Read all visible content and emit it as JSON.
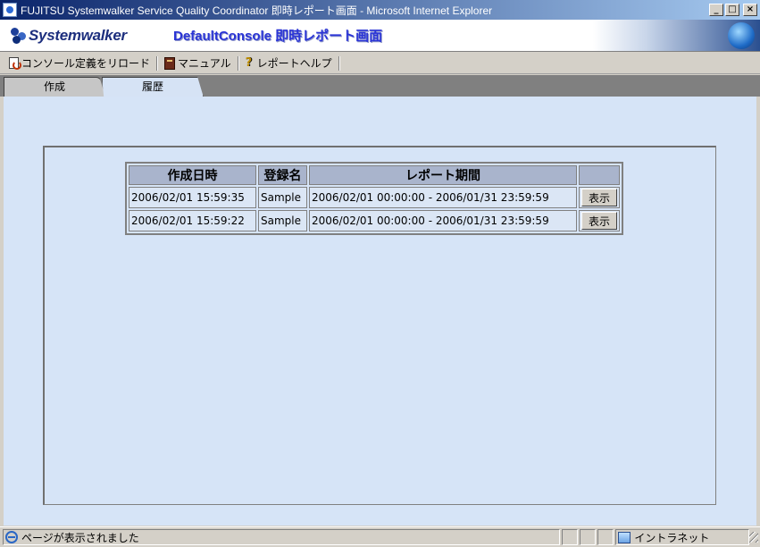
{
  "window": {
    "title": "FUJITSU Systemwalker Service Quality Coordinator 即時レポート画面 - Microsoft Internet Explorer",
    "minimize": "_",
    "maximize": "□",
    "close": "×"
  },
  "banner": {
    "logo": "Systemwalker",
    "title": "DefaultConsole 即時レポート画面"
  },
  "toolbar": {
    "reload": "コンソール定義をリロード",
    "manual": "マニュアル",
    "help": "レポートヘルプ"
  },
  "tabs": [
    {
      "label": "作成",
      "active": false
    },
    {
      "label": "履歴",
      "active": true
    }
  ],
  "history_table": {
    "headers": [
      "作成日時",
      "登録名",
      "レポート期間",
      ""
    ],
    "rows": [
      {
        "created": "2006/02/01 15:59:35",
        "name": "Sample",
        "period": "2006/02/01 00:00:00 - 2006/01/31 23:59:59",
        "button": "表示"
      },
      {
        "created": "2006/02/01 15:59:22",
        "name": "Sample",
        "period": "2006/02/01 00:00:00 - 2006/01/31 23:59:59",
        "button": "表示"
      }
    ]
  },
  "statusbar": {
    "message": "ページが表示されました",
    "zone": "イントラネット"
  }
}
